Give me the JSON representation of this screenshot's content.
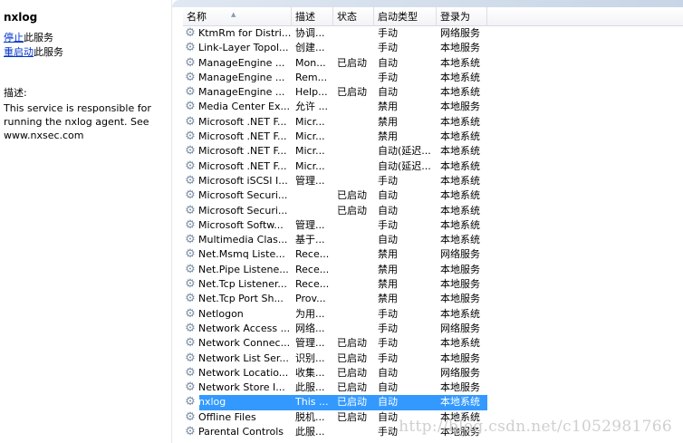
{
  "left_panel": {
    "title": "nxlog",
    "stop_link": "停止",
    "stop_suffix": "此服务",
    "restart_link": "重启动",
    "restart_suffix": "此服务",
    "desc_label": "描述:",
    "desc_text": "This service is responsible for running the nxlog agent. See www.nxsec.com"
  },
  "columns": [
    "名称",
    "描述",
    "状态",
    "启动类型",
    "登录为"
  ],
  "services": [
    {
      "name": "KtmRm for Distri...",
      "desc": "协调...",
      "status": "",
      "startup": "手动",
      "logon": "网络服务"
    },
    {
      "name": "Link-Layer Topol...",
      "desc": "创建...",
      "status": "",
      "startup": "手动",
      "logon": "本地服务"
    },
    {
      "name": "ManageEngine ...",
      "desc": "Mon...",
      "status": "已启动",
      "startup": "自动",
      "logon": "本地系统"
    },
    {
      "name": "ManageEngine ...",
      "desc": "Rem...",
      "status": "",
      "startup": "手动",
      "logon": "本地系统"
    },
    {
      "name": "ManageEngine ...",
      "desc": "Help...",
      "status": "已启动",
      "startup": "自动",
      "logon": "本地系统"
    },
    {
      "name": "Media Center Ex...",
      "desc": "允许 ...",
      "status": "",
      "startup": "禁用",
      "logon": "本地服务"
    },
    {
      "name": "Microsoft .NET F...",
      "desc": "Micr...",
      "status": "",
      "startup": "禁用",
      "logon": "本地系统"
    },
    {
      "name": "Microsoft .NET F...",
      "desc": "Micr...",
      "status": "",
      "startup": "禁用",
      "logon": "本地系统"
    },
    {
      "name": "Microsoft .NET F...",
      "desc": "Micr...",
      "status": "",
      "startup": "自动(延迟...",
      "logon": "本地系统"
    },
    {
      "name": "Microsoft .NET F...",
      "desc": "Micr...",
      "status": "",
      "startup": "自动(延迟...",
      "logon": "本地系统"
    },
    {
      "name": "Microsoft iSCSI I...",
      "desc": "管理...",
      "status": "",
      "startup": "手动",
      "logon": "本地系统"
    },
    {
      "name": "Microsoft Securi...",
      "desc": "",
      "status": "已启动",
      "startup": "自动",
      "logon": "本地系统"
    },
    {
      "name": "Microsoft Securi...",
      "desc": "",
      "status": "已启动",
      "startup": "自动",
      "logon": "本地系统"
    },
    {
      "name": "Microsoft Softw...",
      "desc": "管理...",
      "status": "",
      "startup": "手动",
      "logon": "本地系统"
    },
    {
      "name": "Multimedia Clas...",
      "desc": "基于...",
      "status": "",
      "startup": "自动",
      "logon": "本地系统"
    },
    {
      "name": "Net.Msmq Liste...",
      "desc": "Rece...",
      "status": "",
      "startup": "禁用",
      "logon": "网络服务"
    },
    {
      "name": "Net.Pipe Listene...",
      "desc": "Rece...",
      "status": "",
      "startup": "禁用",
      "logon": "本地服务"
    },
    {
      "name": "Net.Tcp Listener...",
      "desc": "Rece...",
      "status": "",
      "startup": "禁用",
      "logon": "本地服务"
    },
    {
      "name": "Net.Tcp Port Sh...",
      "desc": "Prov...",
      "status": "",
      "startup": "禁用",
      "logon": "本地服务"
    },
    {
      "name": "Netlogon",
      "desc": "为用...",
      "status": "",
      "startup": "手动",
      "logon": "本地系统"
    },
    {
      "name": "Network Access ...",
      "desc": "网络...",
      "status": "",
      "startup": "手动",
      "logon": "网络服务"
    },
    {
      "name": "Network Connec...",
      "desc": "管理...",
      "status": "已启动",
      "startup": "手动",
      "logon": "本地系统"
    },
    {
      "name": "Network List Ser...",
      "desc": "识别...",
      "status": "已启动",
      "startup": "手动",
      "logon": "本地服务"
    },
    {
      "name": "Network Locatio...",
      "desc": "收集...",
      "status": "已启动",
      "startup": "自动",
      "logon": "网络服务"
    },
    {
      "name": "Network Store I...",
      "desc": "此服...",
      "status": "已启动",
      "startup": "自动",
      "logon": "本地服务"
    },
    {
      "name": "nxlog",
      "desc": "This ...",
      "status": "已启动",
      "startup": "自动",
      "logon": "本地系统",
      "selected": true
    },
    {
      "name": "Offline Files",
      "desc": "脱机...",
      "status": "已启动",
      "startup": "自动",
      "logon": "本地系统"
    },
    {
      "name": "Parental Controls",
      "desc": "此服...",
      "status": "",
      "startup": "手动",
      "logon": "本地服务"
    }
  ],
  "icon": "gear-icon",
  "selection_color": "#3399ff",
  "watermark": "http://blog.csdn.net/c1052981766"
}
